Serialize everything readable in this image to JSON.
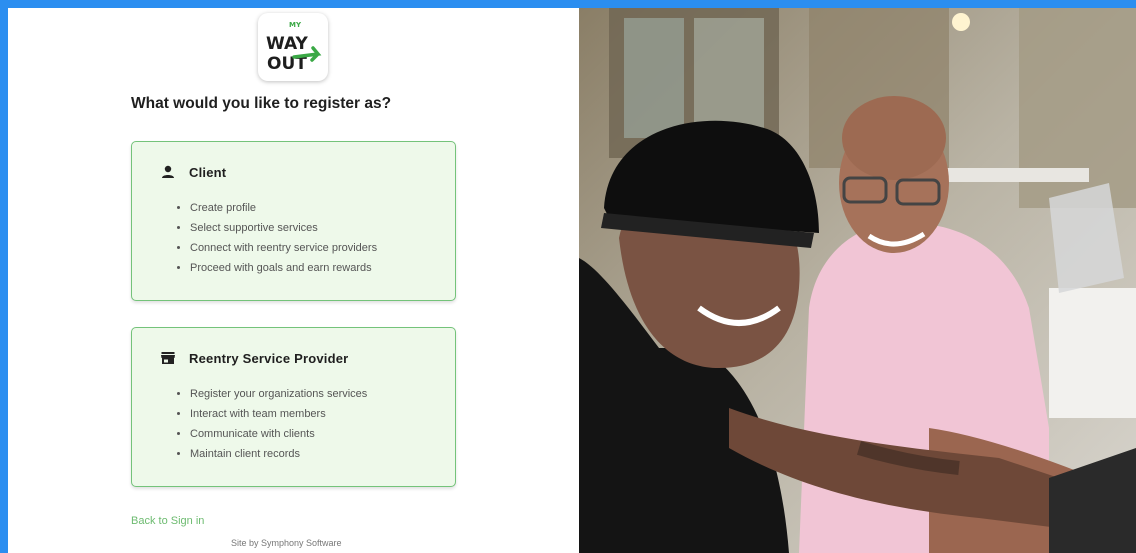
{
  "logo": {
    "top_text": "MY",
    "line1": "WAY",
    "line2": "OUT"
  },
  "heading": "What would you like to register as?",
  "options": [
    {
      "title": "Client",
      "icon": "person-icon",
      "items": [
        "Create profile",
        "Select supportive services",
        "Connect with reentry service providers",
        "Proceed with goals and earn rewards"
      ]
    },
    {
      "title": "Reentry Service Provider",
      "icon": "storefront-icon",
      "items": [
        "Register your organizations services",
        "Interact with team members",
        "Communicate with clients",
        "Maintain client records"
      ]
    }
  ],
  "back_link": "Back to Sign in",
  "credit": "Site by Symphony Software",
  "colors": {
    "border_blue": "#2b8ef0",
    "card_bg": "#eef9ea",
    "card_border": "#74c37a",
    "link_green": "#6dbb70"
  }
}
